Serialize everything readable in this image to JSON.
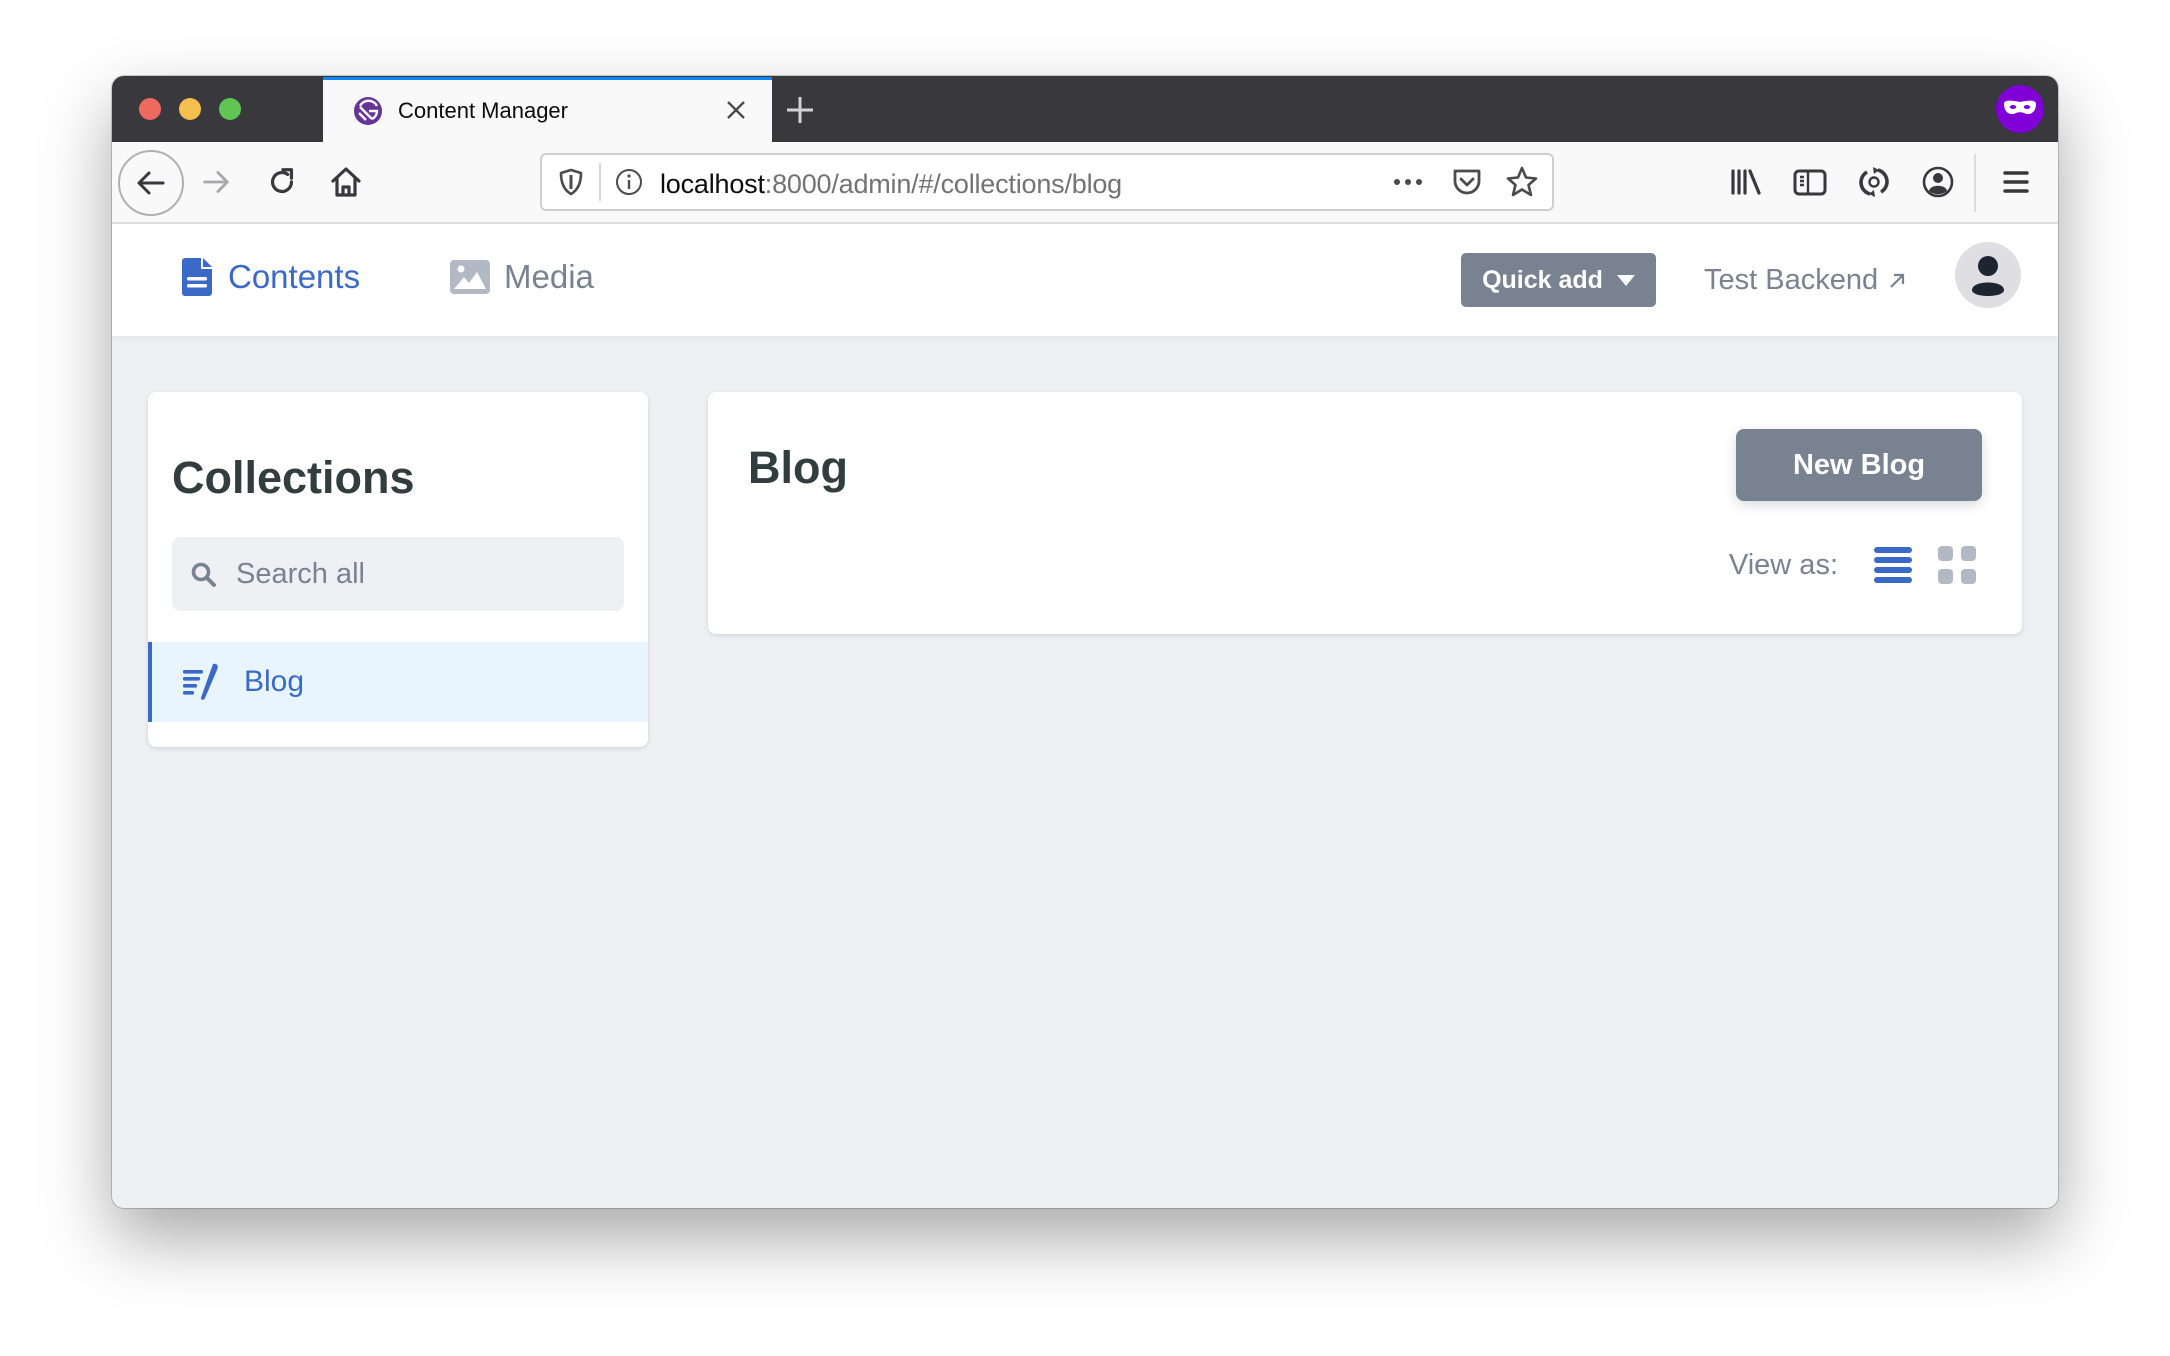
{
  "browser": {
    "tab": {
      "title": "Content Manager",
      "favicon": "gatsby-icon"
    },
    "url": {
      "host": "localhost",
      "rest": ":8000/admin/#/collections/blog"
    },
    "toolbar_icons": [
      "back-icon",
      "forward-icon",
      "reload-icon",
      "home-icon",
      "library-icon",
      "sidebar-icon",
      "sync-icon",
      "account-icon",
      "menu-icon"
    ],
    "private_browsing": true
  },
  "header": {
    "nav": [
      {
        "label": "Contents",
        "icon": "document-icon",
        "active": true
      },
      {
        "label": "Media",
        "icon": "image-icon",
        "active": false
      }
    ],
    "quick_add_label": "Quick add",
    "backend_link_label": "Test Backend",
    "backend_link_arrow": "↗"
  },
  "sidebar": {
    "title": "Collections",
    "search_placeholder": "Search all",
    "collections": [
      {
        "label": "Blog",
        "icon": "blog-icon",
        "active": true
      }
    ]
  },
  "main": {
    "title": "Blog",
    "new_button_label": "New Blog",
    "view_as_label": "View as:",
    "view_modes": [
      {
        "name": "list",
        "active": true
      },
      {
        "name": "grid",
        "active": false
      }
    ]
  },
  "colors": {
    "accent": "#3a69c7",
    "muted": "#798291",
    "heading": "#313d3e",
    "background": "#eff0f4",
    "active_item_bg": "#e8f5fe",
    "tab_highlight": "#0a84ff",
    "private_purple": "#8000d7"
  }
}
